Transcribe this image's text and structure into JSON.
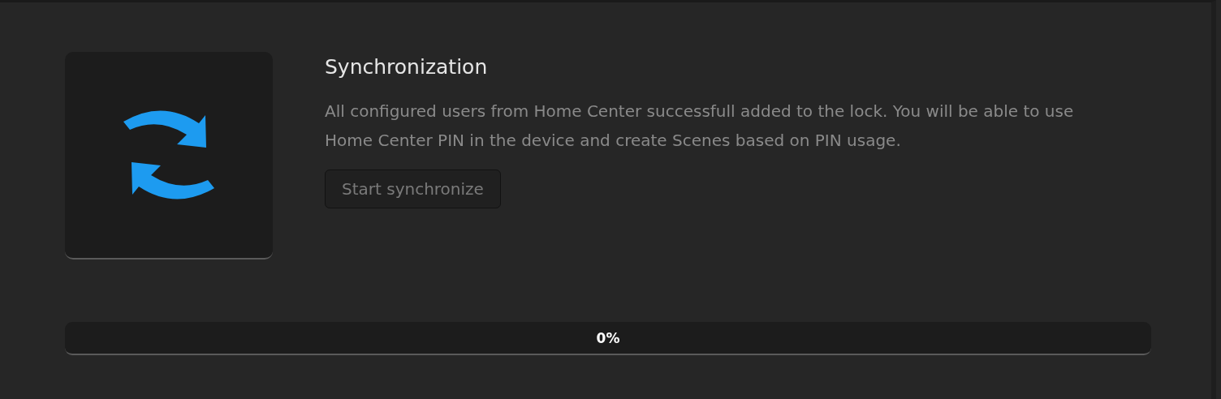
{
  "panel": {
    "title": "Synchronization",
    "description": "All configured users from Home Center successfull added to the lock. You will be able to use Home Center PIN in the device and create Scenes based on PIN usage.",
    "button": "Start synchronize"
  },
  "progress": {
    "level": 0,
    "reading": "0%"
  }
}
